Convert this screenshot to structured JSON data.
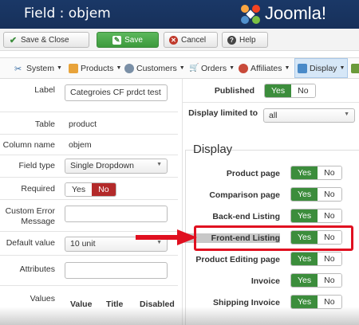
{
  "header": {
    "title": "Field : objem",
    "brand": "Joomla!"
  },
  "toolbar": {
    "save_close": "Save & Close",
    "save": "Save",
    "cancel": "Cancel",
    "help": "Help"
  },
  "menu": {
    "items": [
      "System",
      "Products",
      "Customers",
      "Orders",
      "Affiliates",
      "Display"
    ],
    "active": "Display"
  },
  "left": {
    "label_lbl": "Label",
    "label_val": "Categroies CF prdct test",
    "table_lbl": "Table",
    "table_val": "product",
    "colname_lbl": "Column name",
    "colname_val": "objem",
    "fieldtype_lbl": "Field type",
    "fieldtype_val": "Single Dropdown",
    "required_lbl": "Required",
    "required_yes": "Yes",
    "required_no": "No",
    "error_lbl": "Custom Error Message",
    "default_lbl": "Default value",
    "default_val": "10 unit",
    "attributes_lbl": "Attributes",
    "values_lbl": "Values",
    "values_headers": [
      "Value",
      "Title",
      "Disabled"
    ]
  },
  "right": {
    "published_lbl": "Published",
    "published_yes": "Yes",
    "published_no": "No",
    "limited_lbl": "Display limited to",
    "limited_val": "all",
    "display_legend": "Display",
    "rows": [
      {
        "label": "Product page",
        "yes": "Yes",
        "no": "No"
      },
      {
        "label": "Comparison page",
        "yes": "Yes",
        "no": "No"
      },
      {
        "label": "Back-end Listing",
        "yes": "Yes",
        "no": "No"
      },
      {
        "label": "Front-end Listing",
        "yes": "Yes",
        "no": "No"
      },
      {
        "label": "Product Editing page",
        "yes": "Yes",
        "no": "No"
      },
      {
        "label": "Invoice",
        "yes": "Yes",
        "no": "No"
      },
      {
        "label": "Shipping Invoice",
        "yes": "Yes",
        "no": "No"
      }
    ]
  },
  "colors": {
    "header": "#1a3867",
    "green": "#3c8d3c",
    "red": "#b32a2a",
    "highlight": "#e01020"
  }
}
